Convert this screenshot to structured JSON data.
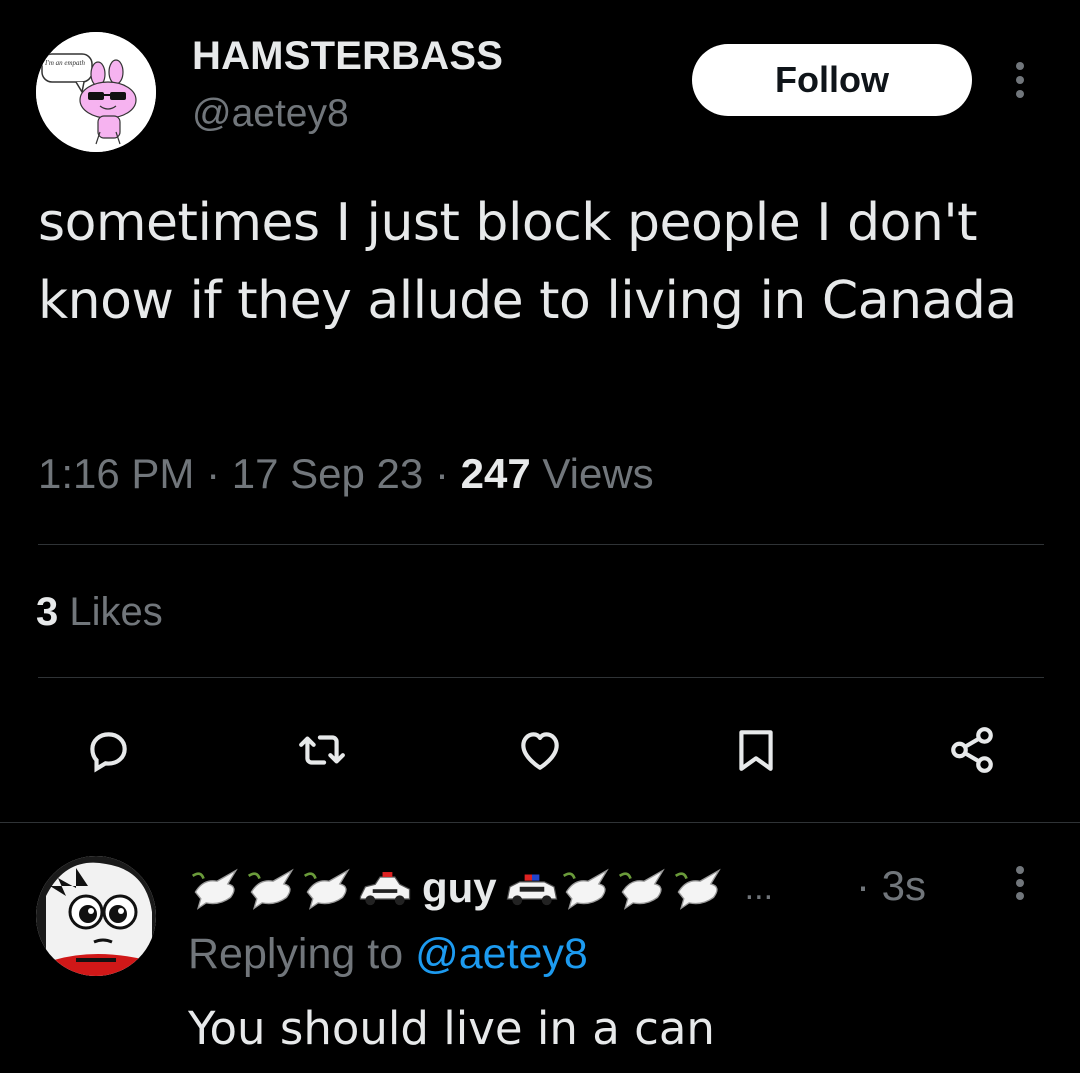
{
  "tweet": {
    "avatar_caption": "I'm an empath",
    "display_name": "HAMSTERBASS",
    "handle": "@aetey8",
    "follow_label": "Follow",
    "text": "sometimes I just block people I don't know if they allude to living in Canada",
    "time": "1:16 PM",
    "date": "17 Sep 23",
    "separator": "·",
    "views_count": "247",
    "views_label": "Views",
    "likes_count": "3",
    "likes_label": "Likes",
    "actions": [
      "reply-icon",
      "retweet-icon",
      "like-icon",
      "bookmark-icon",
      "share-icon"
    ]
  },
  "reply": {
    "display_name": "guy",
    "name_emoji_left": [
      "dove-icon",
      "dove-icon",
      "dove-icon",
      "police-car-icon"
    ],
    "name_emoji_right": [
      "police-car-icon",
      "dove-icon",
      "dove-icon",
      "dove-icon"
    ],
    "ellipsis": "...",
    "time": "· 3s",
    "replying_prefix": "Replying to",
    "replying_handle": "@aetey8",
    "text": "You should live in a can"
  },
  "colors": {
    "background": "#000000",
    "text": "#e7e9ea",
    "muted": "#71767b",
    "link": "#1d9bf0",
    "divider": "#2f3336"
  }
}
